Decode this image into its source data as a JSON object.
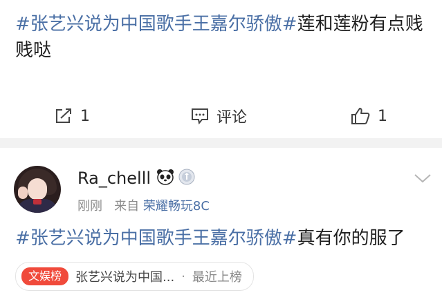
{
  "post1": {
    "topic": "#张艺兴说为中国歌手王嘉尔骄傲#",
    "text": "莲和莲粉有点贱贱哒",
    "actions": {
      "share_count": "1",
      "comment_label": "评论",
      "like_count": "1"
    }
  },
  "post2": {
    "username": "Ra_chelll",
    "time": "刚刚",
    "from_label": "来自",
    "device": "荣耀畅玩8C",
    "topic": "#张艺兴说为中国歌手王嘉尔骄傲#",
    "text": "真有你的服了",
    "hot": {
      "tag": "文娱榜",
      "title": "张艺兴说为中国...",
      "separator": "·",
      "status": "最近上榜"
    }
  },
  "colors": {
    "topic_link": "#4a6fa5",
    "hot_tag_bg": "#f04a3b",
    "divider": "#f2f2f2"
  },
  "icons": {
    "share": "share-icon",
    "comment": "comment-icon",
    "like": "like-icon",
    "panda": "panda-emoji-icon",
    "medal": "medal-badge-icon",
    "chevron": "chevron-down-icon"
  }
}
